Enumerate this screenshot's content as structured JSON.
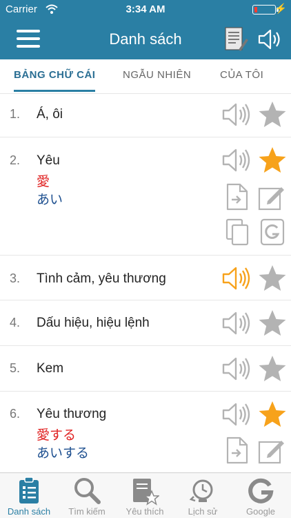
{
  "status_bar": {
    "carrier": "Carrier",
    "time": "3:34 AM"
  },
  "nav": {
    "title": "Danh sách",
    "menu_icon": "hamburger-icon",
    "notes_icon": "notes-icon",
    "sound_icon": "speaker-icon"
  },
  "tabs": [
    {
      "label": "BẢNG CHỮ CÁI",
      "active": true
    },
    {
      "label": "NGẪU NHIÊN",
      "active": false
    },
    {
      "label": "CỦA TÔI",
      "active": false
    }
  ],
  "entries": [
    {
      "number": "1.",
      "word": "Á, ôi",
      "kanji": "",
      "kana": "",
      "audio_playing": false,
      "favorite": false
    },
    {
      "number": "2.",
      "word": "Yêu",
      "kanji": "愛",
      "kana": "あい",
      "audio_playing": false,
      "favorite": true
    },
    {
      "number": "3.",
      "word": "Tình cảm, yêu thương",
      "kanji": "",
      "kana": "",
      "audio_playing": true,
      "favorite": false
    },
    {
      "number": "4.",
      "word": "Dấu hiệu, hiệu lệnh",
      "kanji": "",
      "kana": "",
      "audio_playing": false,
      "favorite": false
    },
    {
      "number": "5.",
      "word": "Kem",
      "kanji": "",
      "kana": "",
      "audio_playing": false,
      "favorite": false
    },
    {
      "number": "6.",
      "word": "Yêu thương",
      "kanji": "愛する",
      "kana": "あいする",
      "audio_playing": false,
      "favorite": true
    }
  ],
  "tab_bar": [
    {
      "label": "Danh sách",
      "icon": "list-clipboard-icon",
      "active": true
    },
    {
      "label": "Tìm kiếm",
      "icon": "search-icon",
      "active": false
    },
    {
      "label": "Yêu thích",
      "icon": "favorite-book-icon",
      "active": false
    },
    {
      "label": "Lịch sử",
      "icon": "history-icon",
      "active": false
    },
    {
      "label": "Google",
      "icon": "google-icon",
      "active": false
    }
  ],
  "colors": {
    "primary": "#2a7fa4",
    "star_active": "#f7a21b",
    "icon_gray": "#b3b3b3",
    "kanji": "#e02020",
    "kana": "#1d4f8f"
  }
}
